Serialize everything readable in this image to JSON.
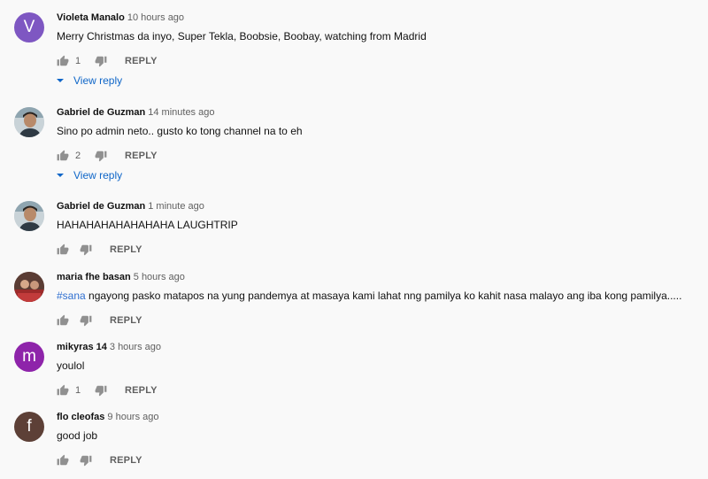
{
  "comments": [
    {
      "author": "Violeta Manalo",
      "time": "10 hours ago",
      "text": "Merry Christmas da inyo, Super Tekla, Boobsie, Boobay, watching from Madrid",
      "likes": "1",
      "reply_label": "REPLY",
      "view_reply": "View reply",
      "avatar": {
        "letter": "V",
        "color": "#7e57c2"
      }
    },
    {
      "author": "Gabriel de Guzman",
      "time": "14 minutes ago",
      "text": "Sino po admin neto.. gusto ko tong channel na to eh",
      "likes": "2",
      "reply_label": "REPLY",
      "view_reply": "View reply",
      "avatar": {
        "icon": "profile-photo"
      }
    },
    {
      "author": "Gabriel de Guzman",
      "time": "1 minute ago",
      "text": "HAHAHAHAHAHAHAHA LAUGHTRIP",
      "likes": "",
      "reply_label": "REPLY",
      "avatar": {
        "icon": "profile-photo"
      }
    },
    {
      "author": "maria fhe basan",
      "time": "5 hours ago",
      "hashtag": "#sana",
      "text": " ngayong pasko matapos na yung pandemya at masaya kami lahat nng pamilya ko kahit nasa malayo ang iba kong pamilya.....",
      "likes": "",
      "reply_label": "REPLY",
      "avatar": {
        "icon": "profile-photo"
      }
    },
    {
      "author": "mikyras 14",
      "time": "3 hours ago",
      "text": "youlol",
      "likes": "1",
      "reply_label": "REPLY",
      "avatar": {
        "letter": "m",
        "color": "#8e24aa"
      }
    },
    {
      "author": "flo cleofas",
      "time": "9 hours ago",
      "text": "good job",
      "likes": "",
      "reply_label": "REPLY",
      "avatar": {
        "letter": "f",
        "color": "#5d4037"
      }
    }
  ],
  "colors": {
    "link": "#0f66c8",
    "hashtag": "#2f6fd0",
    "meta": "#606060"
  }
}
